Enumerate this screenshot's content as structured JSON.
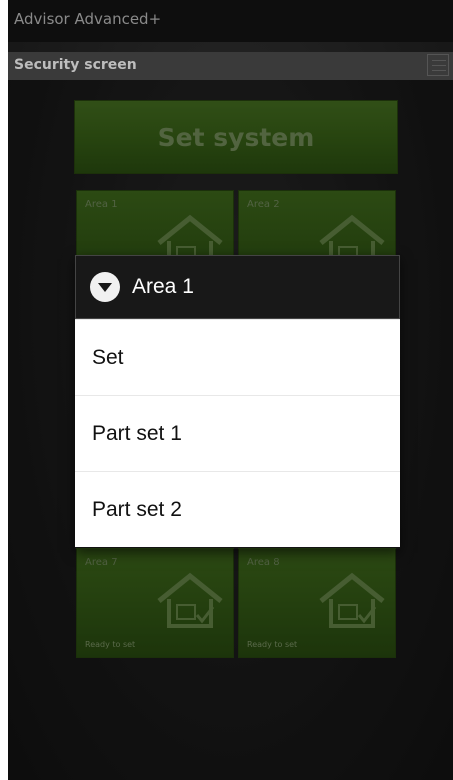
{
  "app": {
    "title": "Advisor Advanced+"
  },
  "header": {
    "title": "Security screen",
    "menu_icon": "grid-menu-icon"
  },
  "main": {
    "set_system_label": "Set system",
    "tiles": [
      {
        "label": "Area 1",
        "status": ""
      },
      {
        "label": "Area 2",
        "status": ""
      },
      {
        "label": "Area 7",
        "status": "Ready to set"
      },
      {
        "label": "Area 8",
        "status": "Ready to set"
      }
    ]
  },
  "dialog": {
    "title": "Area 1",
    "icon": "chevron-down-circle-icon",
    "options": [
      "Set",
      "Part set 1",
      "Part set 2"
    ]
  },
  "colors": {
    "tile_green": "#3c6818",
    "background": "#1c1c1c",
    "dialog_header": "#181818"
  }
}
